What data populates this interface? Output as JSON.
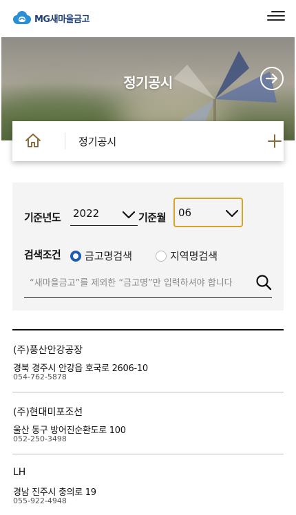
{
  "header": {
    "logo_text": "MG새마을금고",
    "brand_color": "#1d3f7a",
    "menu_icon": "hamburger-icon"
  },
  "hero": {
    "title": "정기공시",
    "arrow_icon": "arrow-right-circle-icon"
  },
  "breadcrumb": {
    "home_icon": "home-icon",
    "label": "정기공시",
    "expand_icon": "plus-icon",
    "accent_color": "#8a6a3c"
  },
  "search": {
    "year_label": "기준년도",
    "year_value": "2022",
    "month_label": "기준월",
    "month_value": "06",
    "condition_label": "검색조건",
    "radio_options": [
      {
        "label": "금고명검색",
        "selected": true
      },
      {
        "label": "지역명검색",
        "selected": false
      }
    ],
    "input_placeholder": "“새마을금고”를 제외한 “금고명”만 입력하셔야 합니다",
    "search_icon": "magnifier-icon",
    "highlight_color": "#d6a326",
    "radio_color": "#1c5cb2"
  },
  "results": [
    {
      "name": "(주)풍산안강공장",
      "address": "경북 경주시 안강읍 호국로 2606-10",
      "phone": "054-762-5878"
    },
    {
      "name": "(주)현대미포조선",
      "address": "울산 동구 방어진순환도로 100",
      "phone": "052-250-3498"
    },
    {
      "name": "LH",
      "address": "경남 진주시 충의로 19",
      "phone": "055-922-4948"
    }
  ]
}
